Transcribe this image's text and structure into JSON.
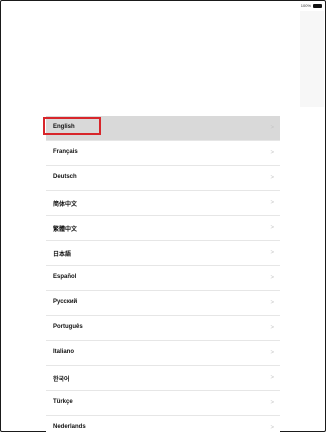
{
  "status_bar": {
    "battery_percent": "100%"
  },
  "languages": [
    {
      "label": "English",
      "selected": true
    },
    {
      "label": "Français",
      "selected": false
    },
    {
      "label": "Deutsch",
      "selected": false
    },
    {
      "label": "简体中文",
      "selected": false
    },
    {
      "label": "繁體中文",
      "selected": false
    },
    {
      "label": "日本語",
      "selected": false
    },
    {
      "label": "Español",
      "selected": false
    },
    {
      "label": "Русский",
      "selected": false
    },
    {
      "label": "Português",
      "selected": false
    },
    {
      "label": "Italiano",
      "selected": false
    },
    {
      "label": "한국어",
      "selected": false
    },
    {
      "label": "Türkçe",
      "selected": false
    },
    {
      "label": "Nederlands",
      "selected": false
    }
  ],
  "chevron_glyph": ">",
  "colors": {
    "highlight": "#d8262b",
    "selected_row": "#d9d9d9"
  }
}
